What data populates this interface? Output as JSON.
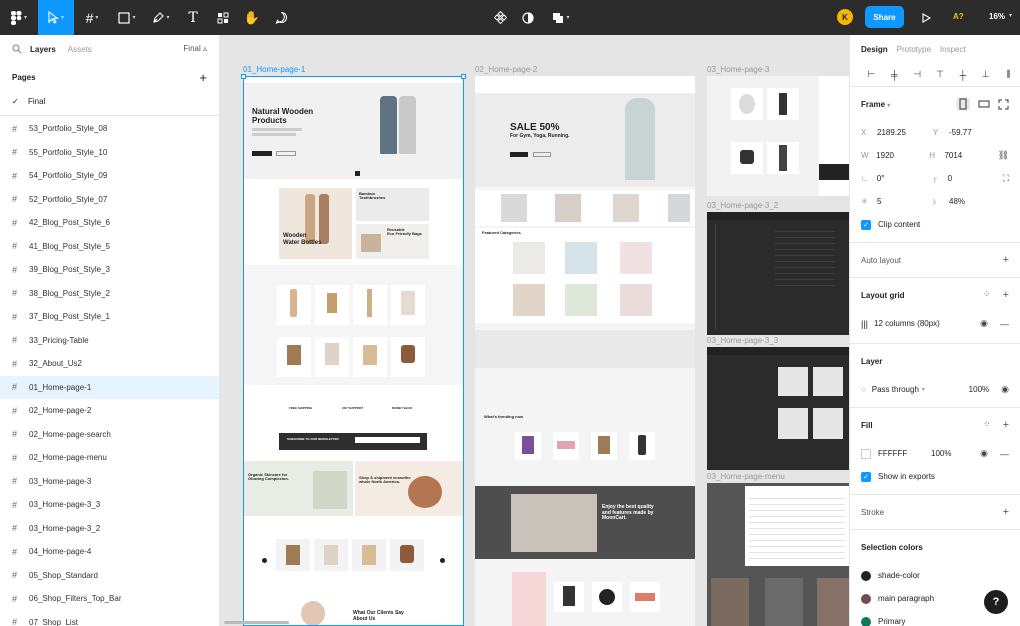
{
  "toolbar": {
    "share_label": "Share",
    "avatar_initial": "K",
    "ai_label": "A?",
    "zoom_label": "16%"
  },
  "left_panel": {
    "tabs": [
      "Layers",
      "Assets"
    ],
    "page_selector": "Final ▵",
    "pages_title": "Pages",
    "pages": [
      {
        "label": "Final",
        "current": true
      }
    ],
    "layers": [
      {
        "label": "53_Portfolio_Style_08"
      },
      {
        "label": "55_Portfolio_Style_10"
      },
      {
        "label": "54_Portfolio_Style_09"
      },
      {
        "label": "52_Portfolio_Style_07"
      },
      {
        "label": "42_Blog_Post_Style_6"
      },
      {
        "label": "41_Blog_Post_Style_5"
      },
      {
        "label": "39_Blog_Post_Style_3"
      },
      {
        "label": "38_Blog_Post_Style_2"
      },
      {
        "label": "37_Blog_Post_Style_1"
      },
      {
        "label": "33_Pricing-Table"
      },
      {
        "label": "32_About_Us2"
      },
      {
        "label": "01_Home-page-1",
        "selected": true
      },
      {
        "label": "02_Home-page-2"
      },
      {
        "label": "02_Home-page-search"
      },
      {
        "label": "02_Home-page-menu"
      },
      {
        "label": "03_Home-page-3"
      },
      {
        "label": "03_Home-page-3_3"
      },
      {
        "label": "03_Home-page-3_2"
      },
      {
        "label": "04_Home-page-4"
      },
      {
        "label": "05_Shop_Standard"
      },
      {
        "label": "06_Shop_Filters_Top_Bar"
      },
      {
        "label": "07_Shop_List"
      }
    ]
  },
  "canvas": {
    "frames": {
      "f1": "01_Home-page-1",
      "f2": "02_Home-page-2",
      "f3": "03_Home-page-3",
      "f4": "03_Home-page-3_2",
      "f5": "03_Home-page-3_3",
      "f6": "03_Home-page-menu"
    },
    "text": {
      "hero1_title": "Natural Wooden\nProducts",
      "hero2_title": "SALE 50%",
      "hero2_sub": "For Gym, Yoga, Running.",
      "wooden": "Wooden\nWater Bottles",
      "bamboo": "Bamboo\nToothbrushes",
      "reusable": "Reusable\nEco Friendly Bags",
      "skincare": "Organic Skincare for\nGlowing Complexion.",
      "shipment": "Shop & shipment ecosothe\nwhole North America.",
      "clients": "What Our Clients Say\nAbout Us",
      "enjoy": "Enjoy the best quality\nand features made by\nMoonCart.",
      "featured": "Featured Categories",
      "trending": "What's trending now",
      "free_ship": "FREE SHIPPING",
      "support": "24/7 SUPPORT",
      "money": "MONEY BACK",
      "subscribe": "SUBSCRIBE TO OUR NEWSLETTER"
    }
  },
  "right_panel": {
    "tabs": [
      "Design",
      "Prototype",
      "Inspect"
    ],
    "frame": {
      "title": "Frame",
      "x_label": "X",
      "x": "2189.25",
      "y_label": "Y",
      "y": "-59.77",
      "w_label": "W",
      "w": "1920",
      "h_label": "H",
      "h": "7014",
      "rotation": "0°",
      "radius": "0",
      "spread": "5",
      "opacity": "48%",
      "clip_content": "Clip content"
    },
    "auto_layout": "Auto layout",
    "layout_grid": {
      "title": "Layout grid",
      "value": "12 columns (80px)"
    },
    "layer": {
      "title": "Layer",
      "blend": "Pass through",
      "opacity": "100%"
    },
    "fill": {
      "title": "Fill",
      "hex": "FFFFFF",
      "opacity": "100%",
      "show_in_exports": "Show in exports"
    },
    "stroke": "Stroke",
    "selection_colors": {
      "title": "Selection colors",
      "items": [
        {
          "label": "shade-color",
          "color": "#222222"
        },
        {
          "label": "main paragraph",
          "color": "#6b5050"
        },
        {
          "label": "Primary",
          "color": "#0f7a5a"
        }
      ]
    }
  },
  "help_label": "?"
}
